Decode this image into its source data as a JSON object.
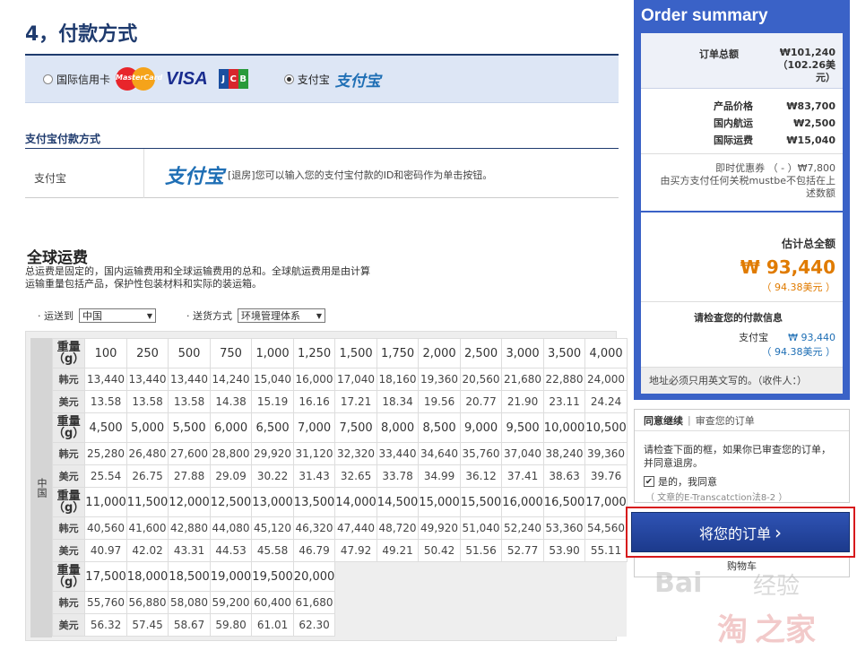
{
  "payment": {
    "title": "4，付款方式",
    "options": {
      "intl_card_label": "国际信用卡",
      "mastercard_text": "MasterCard",
      "visa_text": "VISA",
      "jcb_letters": [
        "J",
        "C",
        "B"
      ],
      "alipay_label": "支付宝",
      "alipay_logo": "支付宝"
    },
    "alipay_section_title": "支付宝付款方式",
    "alipay_row_label": "支付宝",
    "alipay_row_logo": "支付宝",
    "alipay_desc": "[退房]您可以输入您的支付宝付款的ID和密码作为单击按钮。"
  },
  "shipping": {
    "title": "全球运费",
    "desc_line1": "总运费是固定的，国内运输费用和全球运输费用的总和。全球航运费用是由计算",
    "desc_line2": "运输重量包括产品，保护性包装材料和实际的装运箱。",
    "ship_to_label": "· 运送到",
    "ship_to_value": "中国",
    "method_label": "· 送货方式",
    "method_value": "环境管理体系",
    "country": "中国",
    "weight_label": "重量（g）",
    "krw_label": "韩元",
    "usd_label": "美元",
    "groups": [
      {
        "weights": [
          "100",
          "250",
          "500",
          "750",
          "1,000",
          "1,250",
          "1,500",
          "1,750",
          "2,000",
          "2,500",
          "3,000",
          "3,500",
          "4,000"
        ],
        "krw": [
          "13,440",
          "13,440",
          "13,440",
          "14,240",
          "15,040",
          "16,000",
          "17,040",
          "18,160",
          "19,360",
          "20,560",
          "21,680",
          "22,880",
          "24,000"
        ],
        "usd": [
          "13.58",
          "13.58",
          "13.58",
          "14.38",
          "15.19",
          "16.16",
          "17.21",
          "18.34",
          "19.56",
          "20.77",
          "21.90",
          "23.11",
          "24.24"
        ]
      },
      {
        "weights": [
          "4,500",
          "5,000",
          "5,500",
          "6,000",
          "6,500",
          "7,000",
          "7,500",
          "8,000",
          "8,500",
          "9,000",
          "9,500",
          "10,000",
          "10,500"
        ],
        "krw": [
          "25,280",
          "26,480",
          "27,600",
          "28,800",
          "29,920",
          "31,120",
          "32,320",
          "33,440",
          "34,640",
          "35,760",
          "37,040",
          "38,240",
          "39,360"
        ],
        "usd": [
          "25.54",
          "26.75",
          "27.88",
          "29.09",
          "30.22",
          "31.43",
          "32.65",
          "33.78",
          "34.99",
          "36.12",
          "37.41",
          "38.63",
          "39.76"
        ]
      },
      {
        "weights": [
          "11,000",
          "11,500",
          "12,000",
          "12,500",
          "13,000",
          "13,500",
          "14,000",
          "14,500",
          "15,000",
          "15,500",
          "16,000",
          "16,500",
          "17,000"
        ],
        "krw": [
          "40,560",
          "41,600",
          "42,880",
          "44,080",
          "45,120",
          "46,320",
          "47,440",
          "48,720",
          "49,920",
          "51,040",
          "52,240",
          "53,360",
          "54,560"
        ],
        "usd": [
          "40.97",
          "42.02",
          "43.31",
          "44.53",
          "45.58",
          "46.79",
          "47.92",
          "49.21",
          "50.42",
          "51.56",
          "52.77",
          "53.90",
          "55.11"
        ]
      },
      {
        "weights": [
          "17,500",
          "18,000",
          "18,500",
          "19,000",
          "19,500",
          "20,000"
        ],
        "krw": [
          "55,760",
          "56,880",
          "58,080",
          "59,200",
          "60,400",
          "61,680"
        ],
        "usd": [
          "56.32",
          "57.45",
          "58.67",
          "59.80",
          "61.01",
          "62.30"
        ]
      }
    ]
  },
  "summary": {
    "title": "Order summary",
    "order_total_label": "订单总额",
    "order_total_krw": "₩101,240",
    "order_total_usd_1": "（102.26美",
    "order_total_usd_2": "元）",
    "product_price_label": "产品价格",
    "product_price": "₩83,700",
    "domestic_label": "国内航运",
    "domestic": "₩2,500",
    "intl_label": "国际运费",
    "intl": "₩15,040",
    "coupon_label": "即时优惠券 （ - ）",
    "coupon_value": "₩7,800",
    "tax_note_1": "由买方支付任何关税mustbe不包括在上",
    "tax_note_2": "述数额",
    "est_total_label": "估计总全额",
    "est_total_krw": "₩ 93,440",
    "est_total_usd": "（ 94.38美元 ）",
    "check_label": "请检查您的付款信息",
    "pay_method": "支付宝",
    "pay_amount": "₩ 93,440",
    "pay_amount_usd": "（ 94.38美元 ）",
    "address_note": "地址必须只用英文写的。（收件人：）"
  },
  "agree": {
    "tab_active": "同意继续",
    "tab_inactive": "审查您的订单",
    "text_1": "请检查下面的框，如果你已审查您的订单，",
    "text_2": "并同意退房。",
    "checkbox_label": "是的，我同意",
    "law_note": "（ 文章的E-Transcatction法8-2 ）",
    "order_button": "将您的订单",
    "order_arrow": "›",
    "cart_label": "购物车"
  },
  "colors": {
    "brand_blue": "#3a62c7",
    "title_navy": "#1f3b6e",
    "total_orange": "#e07b00",
    "highlight_red": "#d7191c"
  }
}
